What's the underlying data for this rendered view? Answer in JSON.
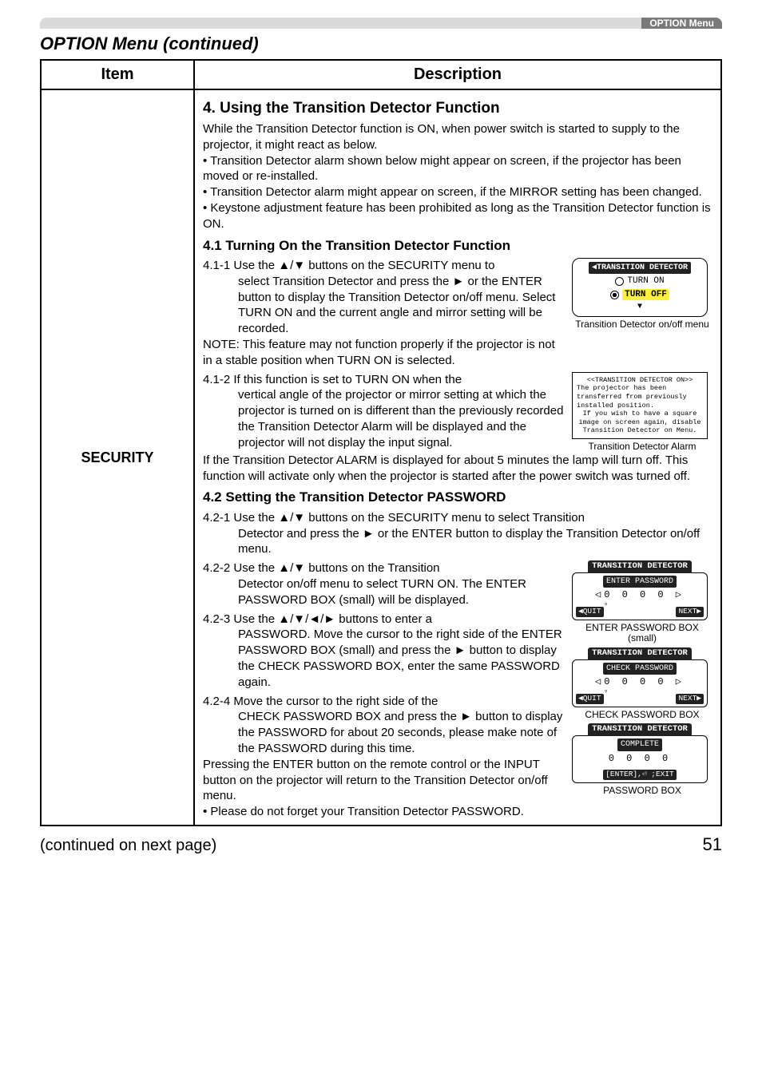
{
  "header": {
    "tab": "OPTION Menu"
  },
  "section_title": "OPTION Menu (continued)",
  "table_headers": {
    "item": "Item",
    "description": "Description"
  },
  "item_label": "SECURITY",
  "desc": {
    "h4": "4. Using the Transition Detector Function",
    "p4_intro": "While the Transition Detector function is ON, when power switch is started to supply to the projector, it might react as below.",
    "p4_b1": "• Transition Detector alarm shown below might appear on screen, if the projector has been moved or re-installed.",
    "p4_b2": "• Transition Detector alarm might appear on screen, if the MIRROR setting has been changed.",
    "p4_b3": "• Keystone adjustment feature has been prohibited as long as the Transition Detector function is ON.",
    "h41": "4.1 Turning On the Transition Detector Function",
    "s411a": "4.1-1 Use the ▲/▼ buttons on the SECURITY menu to",
    "s411b": "select Transition Detector and press the ► or the ENTER button to display the Transition Detector on/off menu. Select TURN ON and the current angle and mirror setting will be recorded.",
    "s411_note": "NOTE: This feature may not function properly if the projector is not in a stable position when TURN ON is selected.",
    "s412a": "4.1-2 If this function is set to TURN ON when the",
    "s412b": "vertical angle of the projector or mirror setting at which the projector is turned on is different than the previously recorded the Transition Detector Alarm will be displayed and the projector will not display the input signal.",
    "s412_after": "If the Transition Detector ALARM is displayed for about 5 minutes the lamp will turn off. This function will activate only when the projector is started after the power switch was turned off.",
    "h42": "4.2 Setting the Transition Detector PASSWORD",
    "s421": "4.2-1 Use the ▲/▼ buttons on the SECURITY menu to select Transition",
    "s421b": "Detector and press the ► or the ENTER button to display the Transition Detector on/off menu.",
    "s422": "4.2-2 Use the ▲/▼ buttons on the Transition",
    "s422b": "Detector on/off menu to select TURN ON. The ENTER PASSWORD BOX (small) will be displayed.",
    "s423": "4.2-3 Use the ▲/▼/◄/► buttons to enter a",
    "s423b": "PASSWORD. Move the cursor to the right side of the ENTER PASSWORD BOX (small) and press the ► button to display the CHECK PASSWORD BOX, enter the same PASSWORD again.",
    "s424": "4.2-4 Move the cursor to the right side of the",
    "s424b": "CHECK PASSWORD BOX and press the ► button to display the PASSWORD for about 20 seconds, please make note of the PASSWORD during this time.",
    "s424c": "Pressing the ENTER button on the remote control or the INPUT button on the projector will return to the Transition Detector on/off menu.",
    "s424d": "• Please do not forget your Transition Detector PASSWORD."
  },
  "osd_onoff": {
    "title": "◀TRANSITION DETECTOR",
    "opt_on": "TURN ON",
    "opt_off": "TURN OFF",
    "caption": "Transition Detector on/off menu"
  },
  "osd_alarm": {
    "hdr": "<<TRANSITION DETECTOR ON>>",
    "l1": "The projector has been transferred from previously installed position.",
    "l2": "If you wish to have a square image on screen again, disable Transition Detector on Menu.",
    "caption": "Transition Detector Alarm"
  },
  "osd_enter": {
    "title": "TRANSITION DETECTOR",
    "sub": "ENTER PASSWORD",
    "digits": "0  0  0",
    "quit": "◀QUIT",
    "next": "NEXT▶",
    "caption": "ENTER PASSWORD BOX (small)"
  },
  "osd_check": {
    "title": "TRANSITION DETECTOR",
    "sub": "CHECK PASSWORD",
    "digits": "0  0  0",
    "quit": "◀QUIT",
    "next": "NEXT▶",
    "caption": "CHECK PASSWORD BOX"
  },
  "osd_complete": {
    "title": "TRANSITION DETECTOR",
    "sub": "COMPLETE",
    "digits": "0  0  0  0",
    "exit": "[ENTER],⏎ ;EXIT",
    "caption": "PASSWORD BOX"
  },
  "footer": {
    "cont": "(continued on next page)",
    "page": "51"
  }
}
